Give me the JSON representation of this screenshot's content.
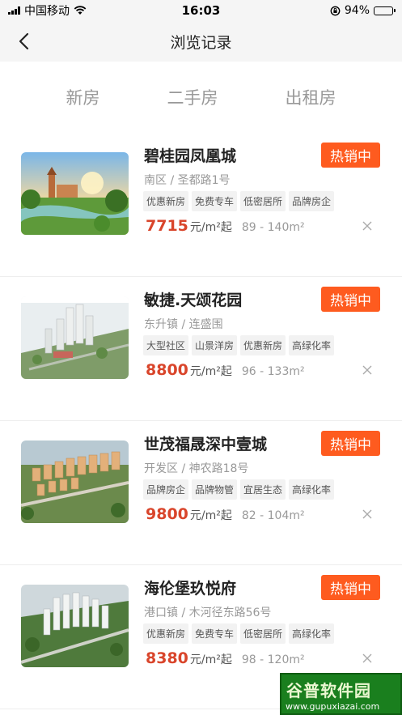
{
  "status_bar": {
    "carrier": "中国移动",
    "time": "16:03",
    "battery": "94%",
    "battery_level": 0.94
  },
  "nav": {
    "title": "浏览记录"
  },
  "tabs": [
    {
      "label": "新房"
    },
    {
      "label": "二手房"
    },
    {
      "label": "出租房"
    }
  ],
  "listings": [
    {
      "name": "碧桂园凤凰城",
      "badge": "热销中",
      "address": "南区 / 圣都路1号",
      "tags": [
        "优惠新房",
        "免费专车",
        "低密居所",
        "品牌房企"
      ],
      "price": "7715",
      "price_unit": "元/m²起",
      "area": "89 - 140m²"
    },
    {
      "name": "敏捷.天颂花园",
      "badge": "热销中",
      "address": "东升镇 / 连盛围",
      "tags": [
        "大型社区",
        "山景洋房",
        "优惠新房",
        "高绿化率"
      ],
      "price": "8800",
      "price_unit": "元/m²起",
      "area": "96 - 133m²"
    },
    {
      "name": "世茂福晟深中壹城",
      "badge": "热销中",
      "address": "开发区 / 神农路18号",
      "tags": [
        "品牌房企",
        "品牌物管",
        "宜居生态",
        "高绿化率"
      ],
      "price": "9800",
      "price_unit": "元/m²起",
      "area": "82 - 104m²"
    },
    {
      "name": "海伦堡玖悦府",
      "badge": "热销中",
      "address": "港口镇 / 木河径东路56号",
      "tags": [
        "优惠新房",
        "免费专车",
        "低密居所",
        "高绿化率"
      ],
      "price": "8380",
      "price_unit": "元/m²起",
      "area": "98 - 120m²"
    }
  ],
  "watermark": {
    "title": "谷普软件园",
    "url": "www.gupuxiazai.com"
  }
}
